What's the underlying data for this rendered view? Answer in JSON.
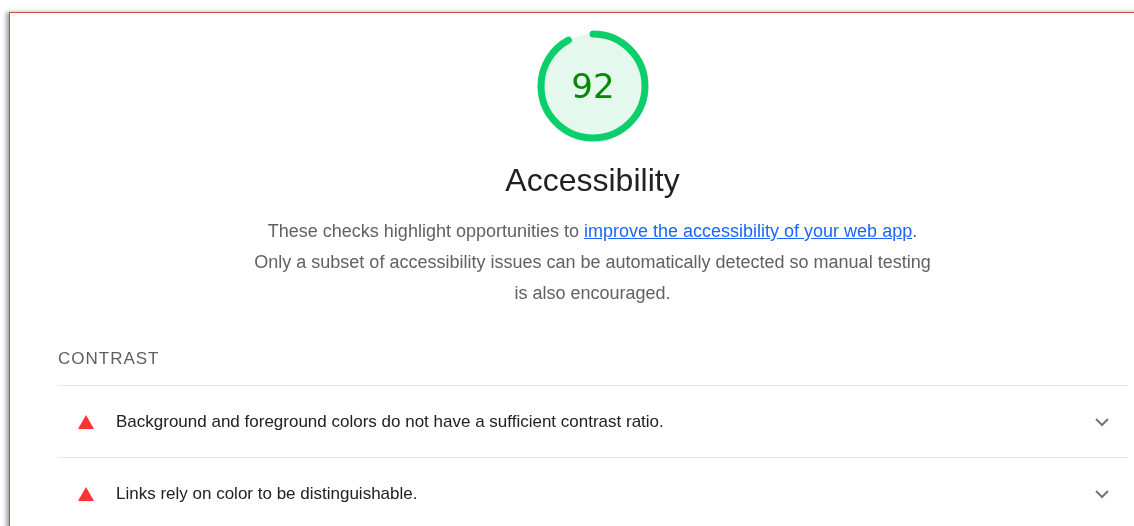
{
  "gauge": {
    "score": "92"
  },
  "title": "Accessibility",
  "description": {
    "before": "These checks highlight opportunities to ",
    "link": "improve the accessibility of your web app",
    "after": ". Only a subset of accessibility issues can be automatically detected so manual testing is also encouraged."
  },
  "group": {
    "heading": "CONTRAST",
    "audits": [
      {
        "kind": "fail",
        "text": "Background and foreground colors do not have a sufficient contrast ratio.",
        "expanded": false
      },
      {
        "kind": "fail",
        "text": "Links rely on color to be distinguishable.",
        "expanded": false
      }
    ]
  }
}
